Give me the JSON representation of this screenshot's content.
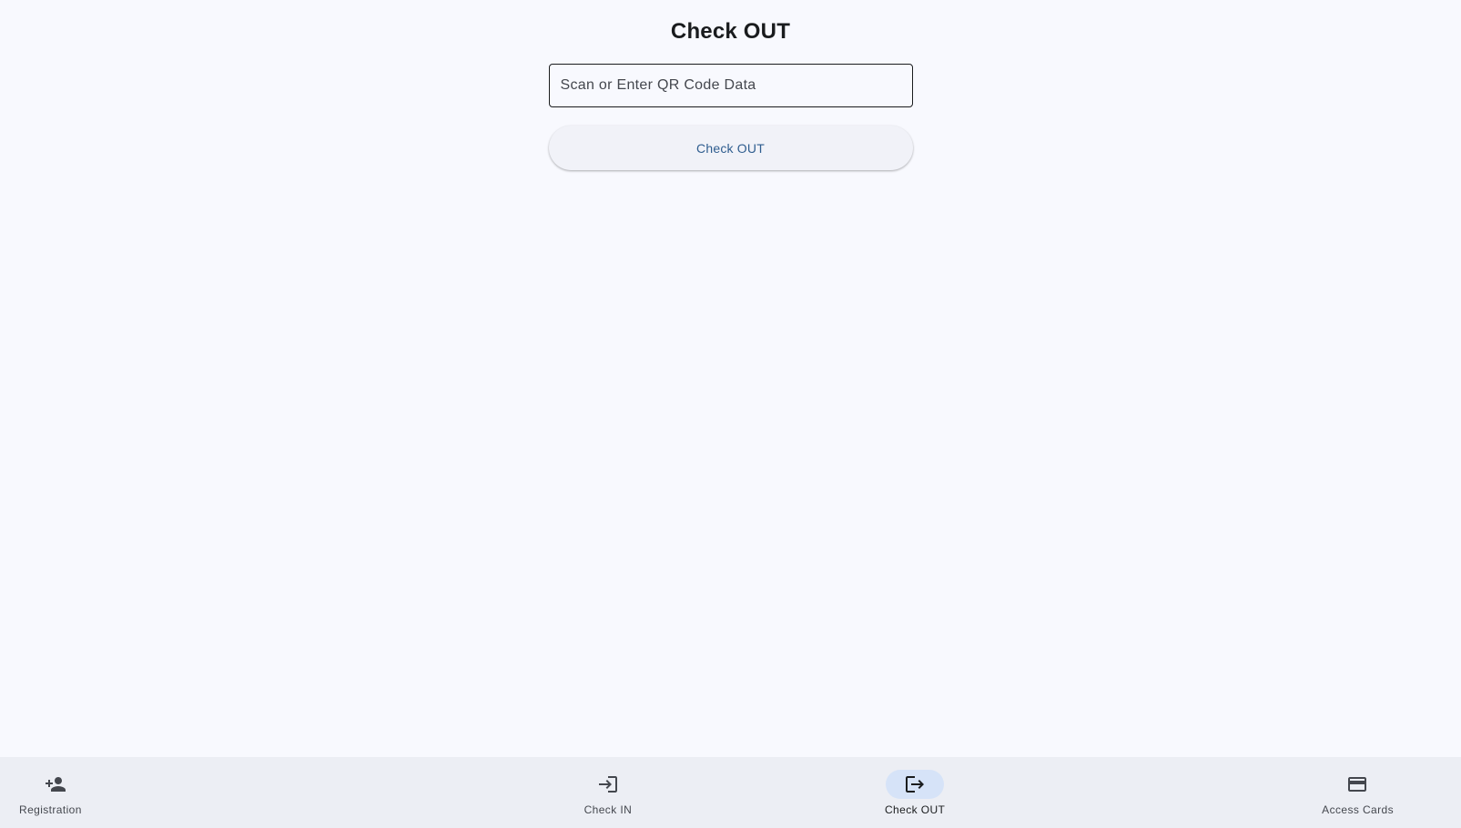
{
  "page": {
    "title": "Check OUT"
  },
  "qr_input": {
    "placeholder": "Scan or Enter QR Code Data",
    "value": ""
  },
  "actions": {
    "checkout_label": "Check OUT"
  },
  "bottom_nav": {
    "active": "Check OUT",
    "items": [
      {
        "label": "Registration",
        "icon": "person-add-icon"
      },
      {
        "label": "Check IN",
        "icon": "login-icon"
      },
      {
        "label": "Check OUT",
        "icon": "logout-icon"
      },
      {
        "label": "Access Cards",
        "icon": "credit-card-icon"
      }
    ]
  },
  "colors": {
    "background": "#f8f9fe",
    "nav_background": "#eceef4",
    "active_indicator": "#d6e3f8",
    "button_text": "#2f5d8f"
  }
}
